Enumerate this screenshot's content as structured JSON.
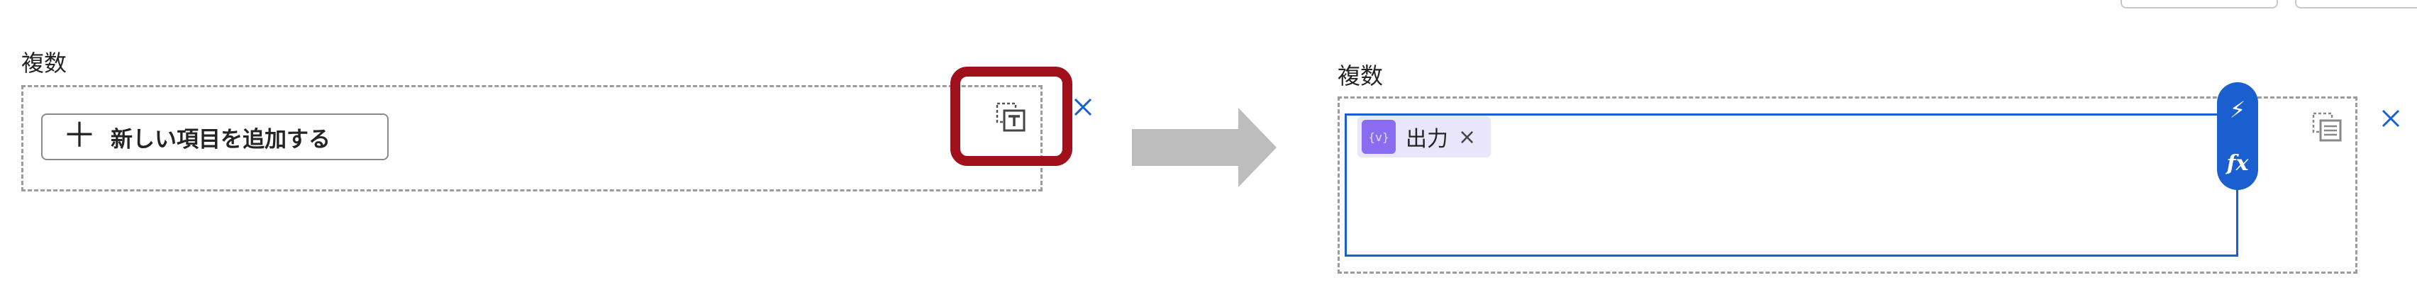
{
  "left": {
    "label": "複数",
    "add_button": {
      "plus": "＋",
      "label": "新しい項目を追加する"
    }
  },
  "right": {
    "label": "複数",
    "token": {
      "icon": "{v}",
      "label": "出力",
      "remove": "×"
    },
    "pill": {
      "bolt": "⚡",
      "fx": "fx"
    }
  },
  "colors": {
    "highlight": "#a0101b",
    "accent": "#1a5fd0",
    "arrow": "#bdbdbd",
    "token_bg": "#e9e6fb",
    "token_icon": "#8a6cf0"
  }
}
